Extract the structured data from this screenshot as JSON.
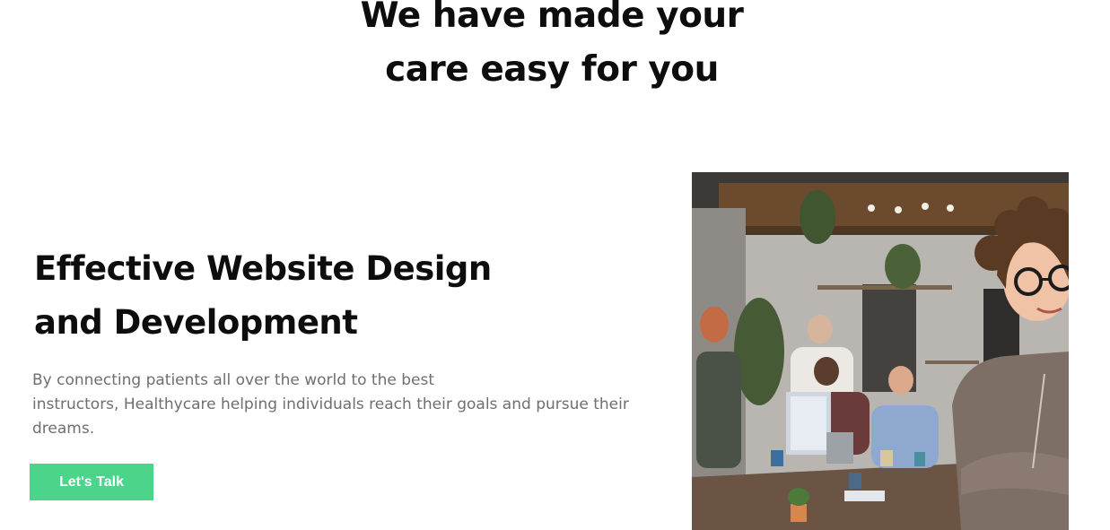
{
  "section": {
    "heading_line1": "We have made your",
    "heading_line2": "care easy for you"
  },
  "feature": {
    "title_line1": "Effective Website Design",
    "title_line2": "and Development",
    "description_line1": "By connecting patients all over the world to the best",
    "description_line2": "instructors, Healthycare helping individuals reach their goals and pursue their",
    "description_line3": "dreams.",
    "cta_label": "Let's Talk"
  },
  "image": {
    "subject": "office-team-photo"
  },
  "colors": {
    "accent": "#4cd48a",
    "heading": "#0d0d0d",
    "body_text": "#6f6f6f",
    "background": "#ffffff"
  }
}
